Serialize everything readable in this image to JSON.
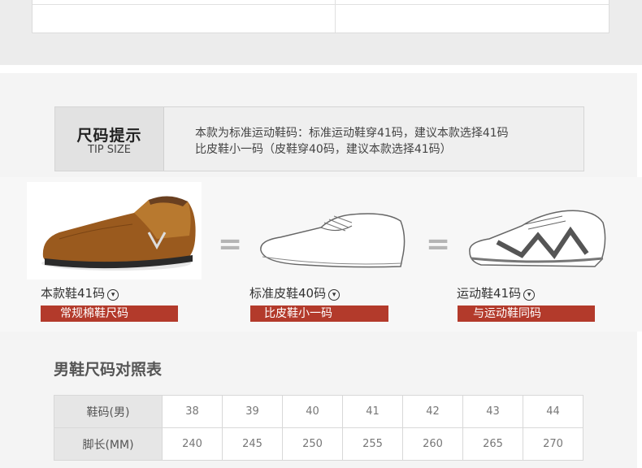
{
  "tip": {
    "title": "尺码提示",
    "subtitle": "TIP SIZE",
    "line1": "本款为标准运动鞋码：标准运动鞋穿41码，建议本款选择41码",
    "line2": "比皮鞋小一码（皮鞋穿40码，建议本款选择41码）"
  },
  "shoes": [
    {
      "caption": "本款鞋41码",
      "tag": "常规棉鞋尺码",
      "icon": "chevron-down-circle-icon"
    },
    {
      "caption": "标准皮鞋40码",
      "tag": "比皮鞋小一码",
      "icon": "chevron-down-circle-icon"
    },
    {
      "caption": "运动鞋41码",
      "tag": "与运动鞋同码",
      "icon": "chevron-down-circle-icon"
    }
  ],
  "equals_symbol": "=",
  "size_chart": {
    "title": "男鞋尺码对照表",
    "row1_label": "鞋码(男)",
    "row2_label": "脚长(MM)",
    "sizes": [
      "38",
      "39",
      "40",
      "41",
      "42",
      "43",
      "44"
    ],
    "lengths": [
      "240",
      "245",
      "250",
      "255",
      "260",
      "265",
      "270"
    ]
  },
  "colors": {
    "tag_red": "#b33a2b",
    "header_gray": "#e6e6e6"
  }
}
